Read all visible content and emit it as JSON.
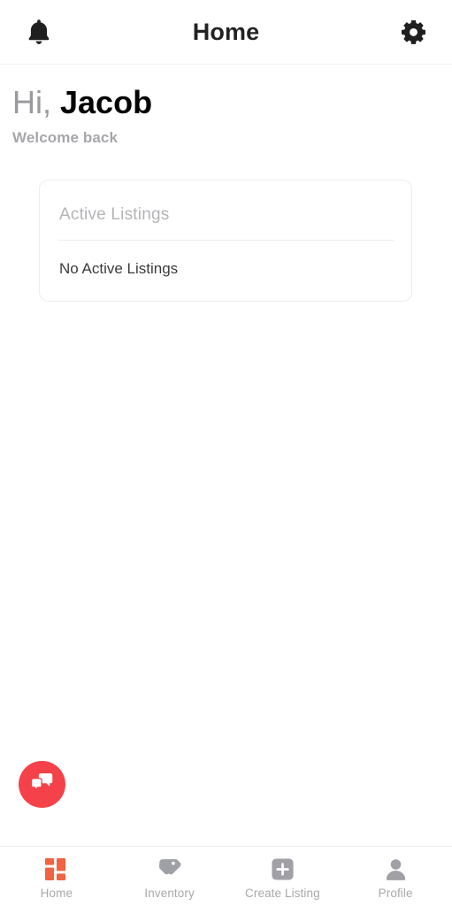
{
  "header": {
    "title": "Home",
    "notification_icon": "bell-icon",
    "settings_icon": "gear-icon"
  },
  "greeting": {
    "hi": "Hi,",
    "name": "Jacob",
    "subtitle": "Welcome back"
  },
  "card": {
    "title": "Active Listings",
    "empty_message": "No Active Listings"
  },
  "fab": {
    "icon": "chat-bubbles-icon",
    "color": "#f5424a"
  },
  "bottom_nav": {
    "active_color": "#f06343",
    "inactive_color": "#a0a0a6",
    "items": [
      {
        "label": "Home",
        "icon": "dashboard-grid-icon",
        "active": "true"
      },
      {
        "label": "Inventory",
        "icon": "price-tag-icon",
        "active": "false"
      },
      {
        "label": "Create Listing",
        "icon": "plus-square-icon",
        "active": "false"
      },
      {
        "label": "Profile",
        "icon": "person-icon",
        "active": "false"
      }
    ]
  }
}
